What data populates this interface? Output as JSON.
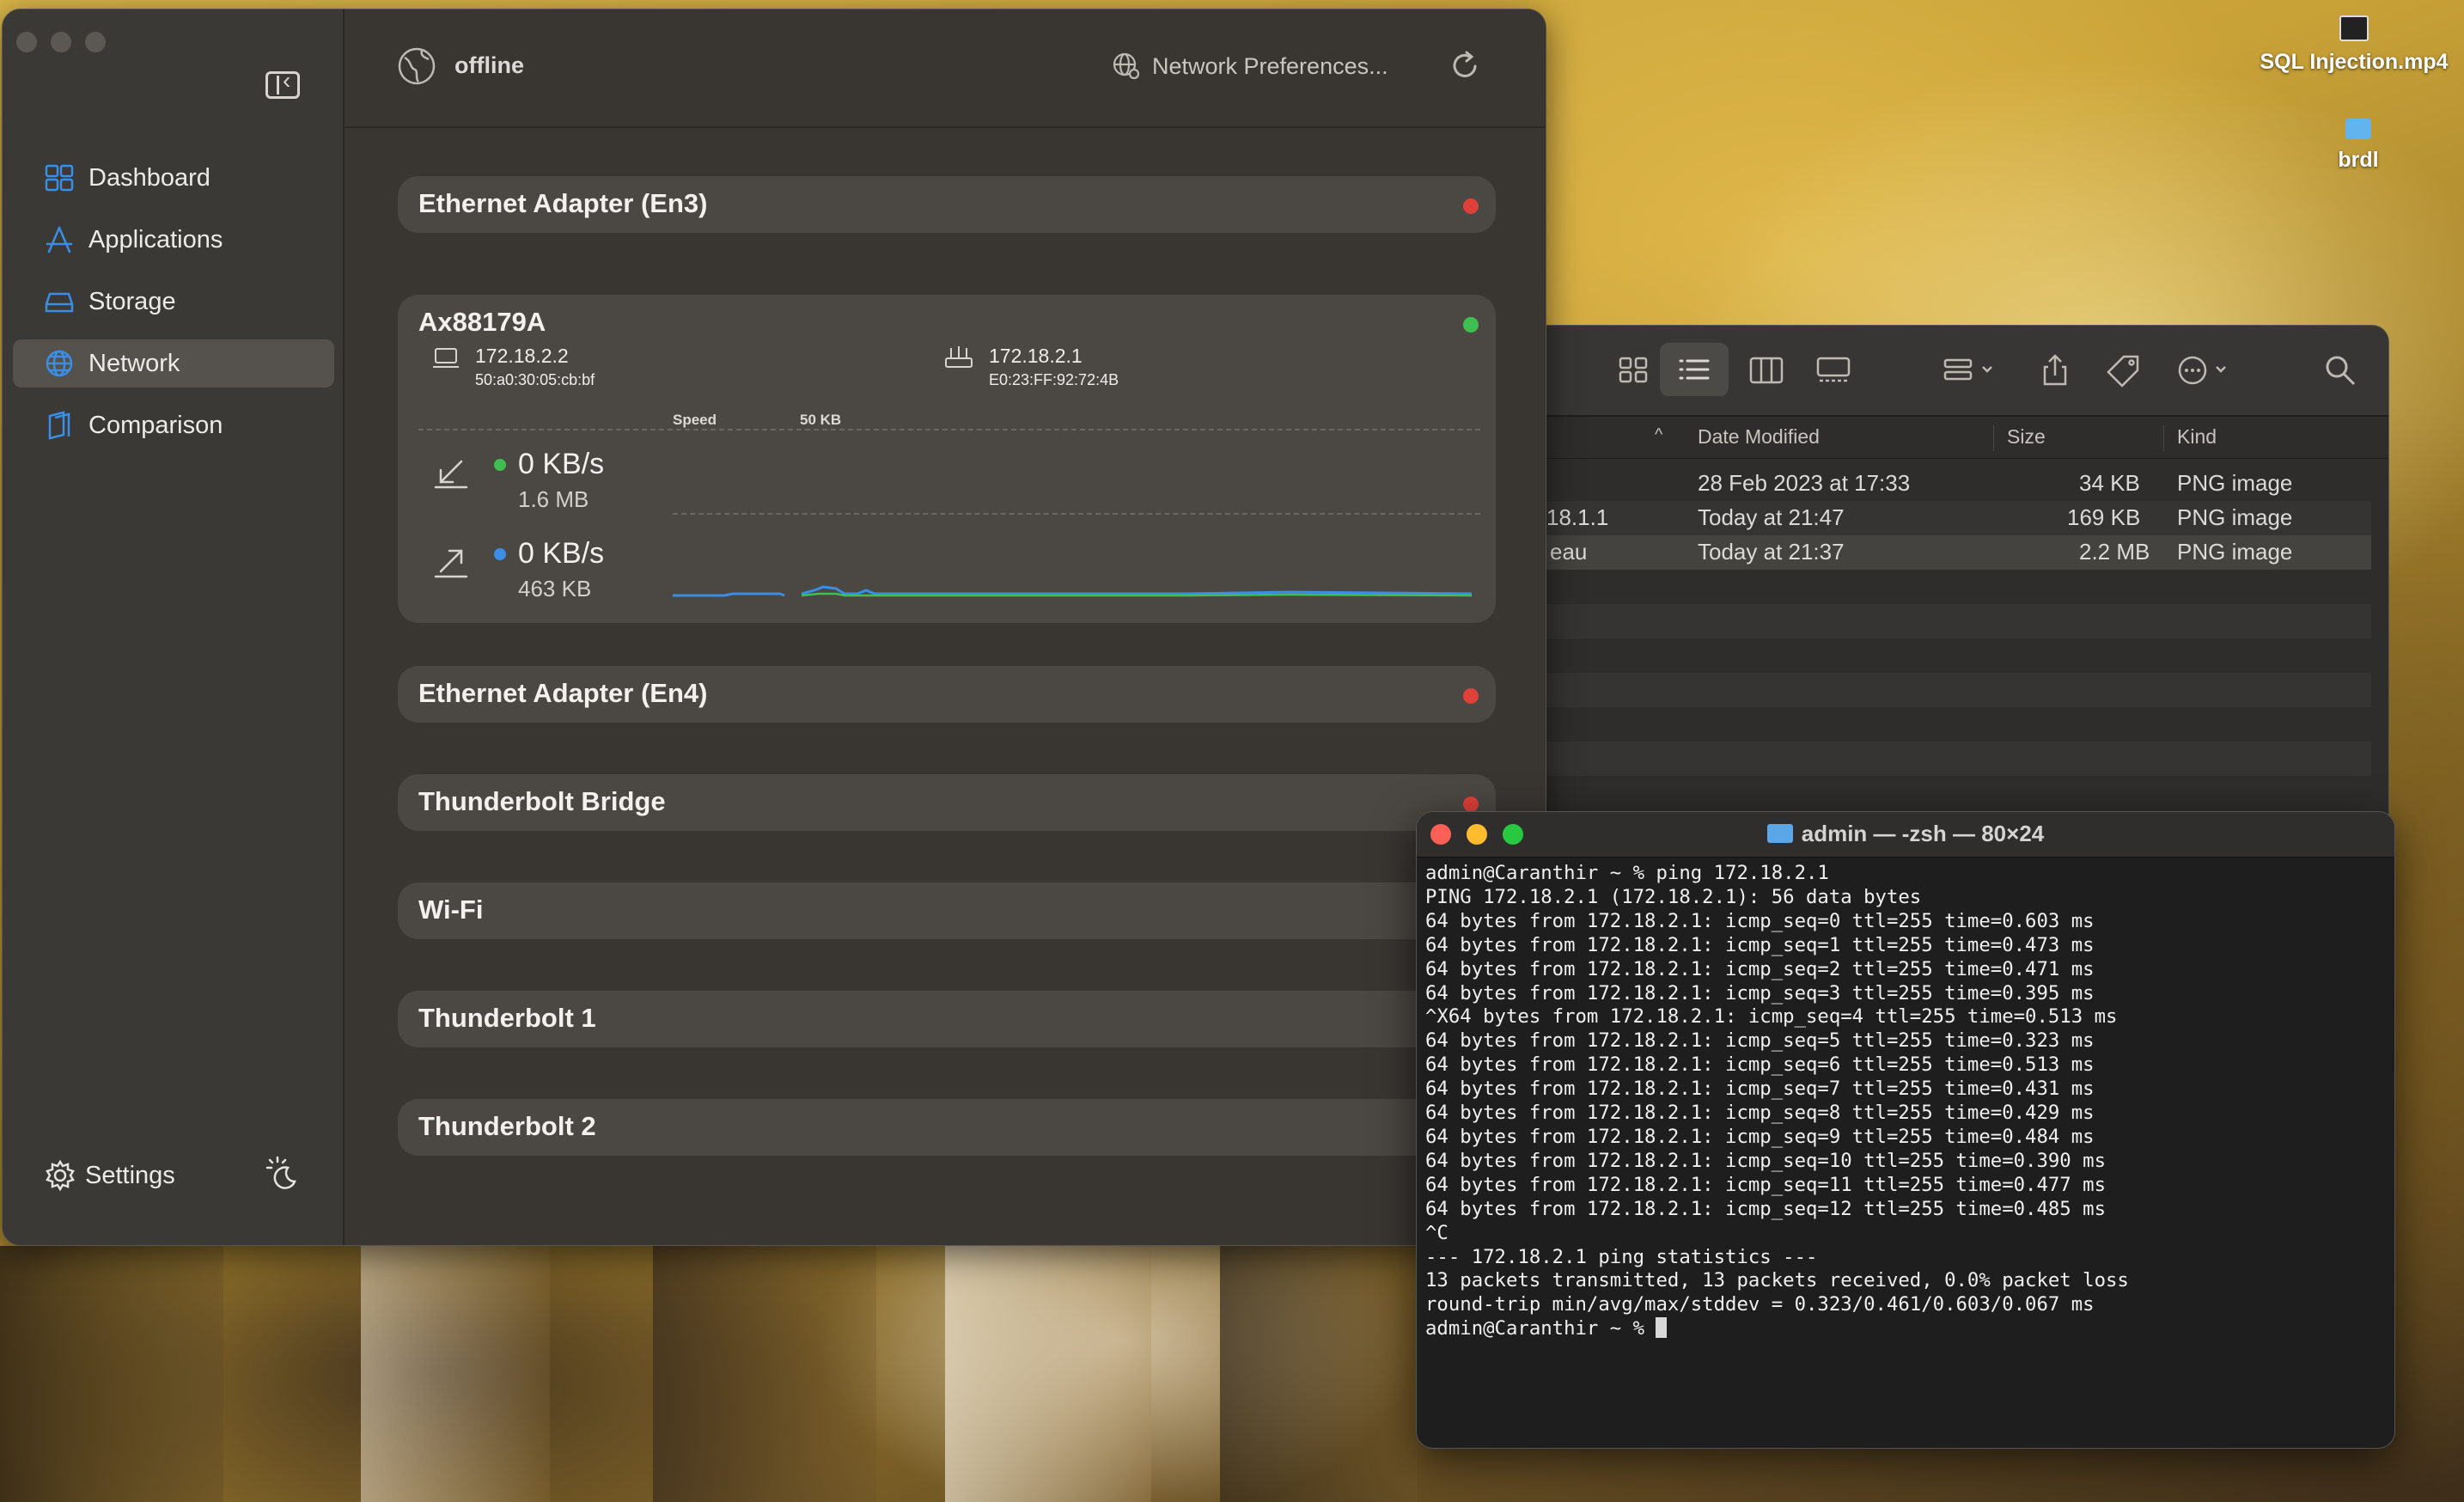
{
  "desktop": {
    "icons": [
      {
        "label": "SQL Injection.mp4",
        "icon": "video-file-icon"
      },
      {
        "label": "brdl",
        "icon": "folder-icon"
      }
    ]
  },
  "app": {
    "sidebar": {
      "items": [
        {
          "label": "Dashboard",
          "icon": "dashboard-icon",
          "active": false
        },
        {
          "label": "Applications",
          "icon": "applications-icon",
          "active": false
        },
        {
          "label": "Storage",
          "icon": "storage-icon",
          "active": false
        },
        {
          "label": "Network",
          "icon": "globe-icon",
          "active": true
        },
        {
          "label": "Comparison",
          "icon": "comparison-icon",
          "active": false
        }
      ],
      "settings_label": "Settings"
    },
    "header": {
      "status": "offline",
      "network_prefs_label": "Network Preferences..."
    },
    "adapters": [
      {
        "name": "Ethernet Adapter (En3)",
        "status": "offline"
      },
      {
        "name": "Ax88179A",
        "status": "online",
        "local": {
          "ip": "172.18.2.2",
          "mac": "50:a0:30:05:cb:bf"
        },
        "router": {
          "ip": "172.18.2.1",
          "mac": "E0:23:FF:92:72:4B"
        },
        "chart_axis": {
          "speed_label": "Speed",
          "scale_label": "50 KB"
        },
        "download": {
          "rate": "0 KB/s",
          "total": "1.6 MB"
        },
        "upload": {
          "rate": "0 KB/s",
          "total": "463 KB"
        }
      },
      {
        "name": "Ethernet Adapter (En4)",
        "status": "offline"
      },
      {
        "name": "Thunderbolt Bridge",
        "status": "offline"
      },
      {
        "name": "Wi-Fi",
        "status": "unknown"
      },
      {
        "name": "Thunderbolt 1",
        "status": "unknown"
      },
      {
        "name": "Thunderbolt 2",
        "status": "unknown"
      }
    ],
    "colors": {
      "online": "#3fbf4f",
      "offline": "#e0403a",
      "download": "#3fbf4f",
      "upload": "#3a8ee6"
    }
  },
  "finder": {
    "columns": {
      "date": "Date Modified",
      "size": "Size",
      "kind": "Kind"
    },
    "rows": [
      {
        "name": "",
        "date": "28 Feb 2023 at 17:33",
        "size": "34 KB",
        "kind": "PNG image"
      },
      {
        "name": "18.1.1",
        "date": "Today at 21:47",
        "size": "169 KB",
        "kind": "PNG image"
      },
      {
        "name": "eau",
        "date": "Today at 21:37",
        "size": "2.2 MB",
        "kind": "PNG image"
      }
    ]
  },
  "terminal": {
    "title": "admin — -zsh — 80×24",
    "lines": [
      "admin@Caranthir ~ % ping 172.18.2.1",
      "PING 172.18.2.1 (172.18.2.1): 56 data bytes",
      "64 bytes from 172.18.2.1: icmp_seq=0 ttl=255 time=0.603 ms",
      "64 bytes from 172.18.2.1: icmp_seq=1 ttl=255 time=0.473 ms",
      "64 bytes from 172.18.2.1: icmp_seq=2 ttl=255 time=0.471 ms",
      "64 bytes from 172.18.2.1: icmp_seq=3 ttl=255 time=0.395 ms",
      "^X64 bytes from 172.18.2.1: icmp_seq=4 ttl=255 time=0.513 ms",
      "64 bytes from 172.18.2.1: icmp_seq=5 ttl=255 time=0.323 ms",
      "64 bytes from 172.18.2.1: icmp_seq=6 ttl=255 time=0.513 ms",
      "64 bytes from 172.18.2.1: icmp_seq=7 ttl=255 time=0.431 ms",
      "64 bytes from 172.18.2.1: icmp_seq=8 ttl=255 time=0.429 ms",
      "64 bytes from 172.18.2.1: icmp_seq=9 ttl=255 time=0.484 ms",
      "64 bytes from 172.18.2.1: icmp_seq=10 ttl=255 time=0.390 ms",
      "64 bytes from 172.18.2.1: icmp_seq=11 ttl=255 time=0.477 ms",
      "64 bytes from 172.18.2.1: icmp_seq=12 ttl=255 time=0.485 ms",
      "^C",
      "--- 172.18.2.1 ping statistics ---",
      "13 packets transmitted, 13 packets received, 0.0% packet loss",
      "round-trip min/avg/max/stddev = 0.323/0.461/0.603/0.067 ms"
    ],
    "prompt": "admin@Caranthir ~ % "
  }
}
